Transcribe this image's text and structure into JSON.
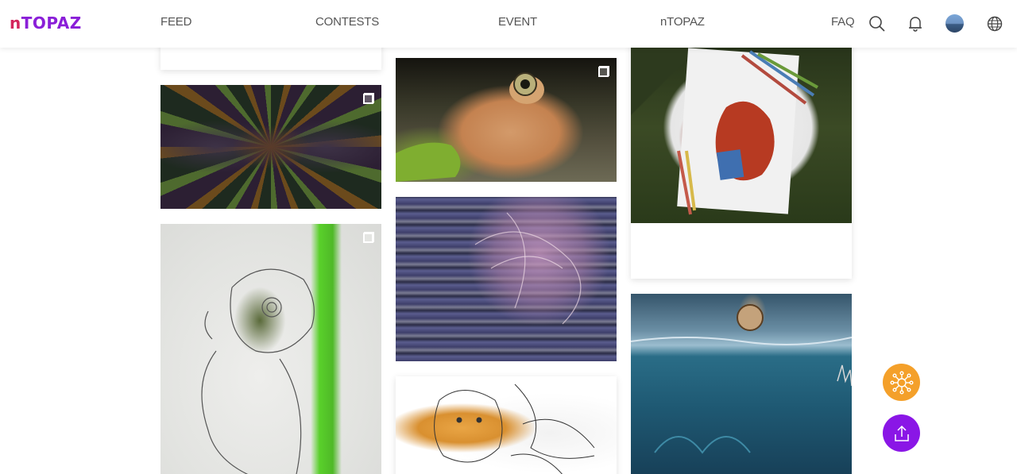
{
  "brand": {
    "logo_prefix": "n",
    "logo_rest": "TOPAZ"
  },
  "nav": {
    "feed": "FEED",
    "contests": "CONTESTS",
    "event": "EVENT",
    "ntopaz": "nTOPAZ",
    "faq": "FAQ"
  },
  "icons": {
    "search": "search-icon",
    "notifications": "bell-icon",
    "profile": "avatar",
    "language": "globe-icon",
    "select": "select-checkbox-icon",
    "rewards": "network-coin-icon",
    "upload": "upload-icon"
  },
  "colors": {
    "logo_n": "#d3265c",
    "logo_text": "#8a1fd8",
    "fab_rewards": "#f4a02a",
    "fab_upload": "#8a16e6"
  }
}
